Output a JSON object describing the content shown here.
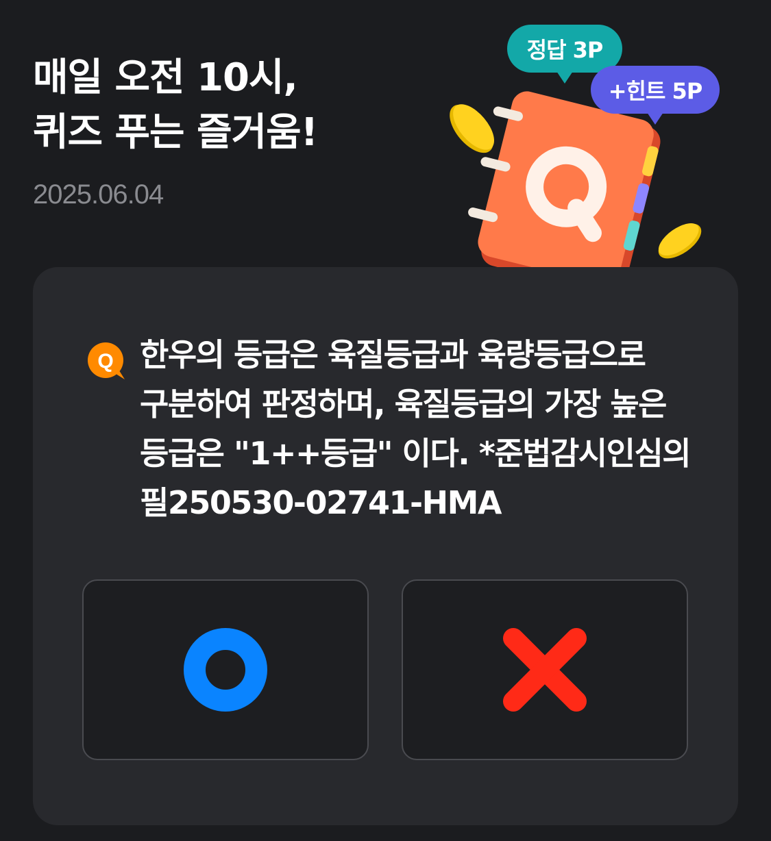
{
  "header": {
    "title_line1": "매일 오전 10시,",
    "title_line2": "퀴즈 푸는 즐거움!",
    "date": "2025.06.04"
  },
  "illustration": {
    "badge_answer": "정답 3P",
    "badge_hint": "+힌트 5P",
    "notebook_letter": "Q"
  },
  "quiz": {
    "q_badge": "Q",
    "question_line1": "한우의 등급은 육질등급과 육량등급으로",
    "question_line2": "구분하여 판정하며, 육질등급의 가장 높은",
    "question_line3": "등급은 \"1++등급\" 이다. *준법감시인심의",
    "question_line4": "필250530-02741-HMA",
    "options": [
      {
        "icon": "o-icon",
        "color": "#0a84ff"
      },
      {
        "icon": "x-icon",
        "color": "#ff2a17"
      }
    ]
  },
  "colors": {
    "background": "#1b1c1f",
    "card": "#28292d",
    "accent_orange": "#ff8a00",
    "teal": "#13a8a8",
    "purple": "#5c5ce6"
  }
}
